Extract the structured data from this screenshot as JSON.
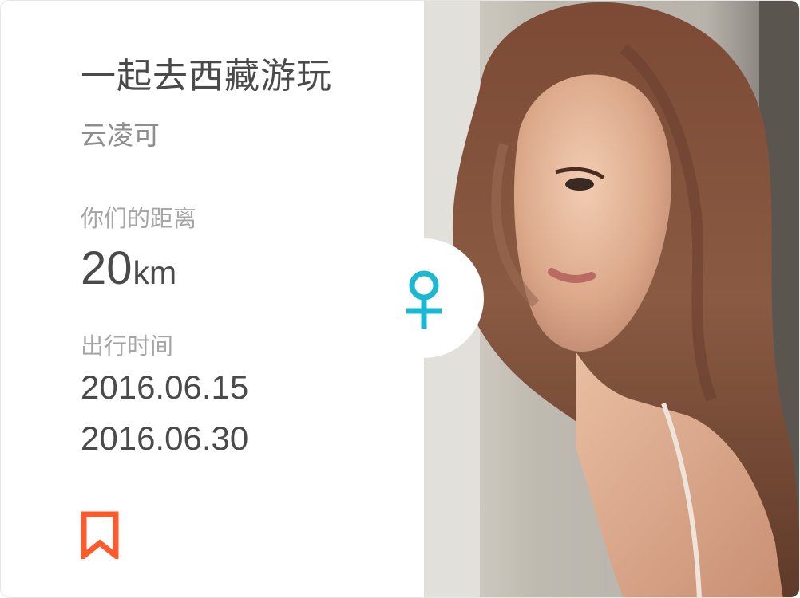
{
  "trip": {
    "title": "一起去西藏游玩",
    "author": "云凌可",
    "distance_label": "你们的距离",
    "distance_value": "20",
    "distance_unit": "km",
    "time_label": "出行时间",
    "start_date": "2016.06.15",
    "end_date": "2016.06.30"
  },
  "icons": {
    "bookmark": "bookmark-icon",
    "gender": "female-icon",
    "photo": "profile-photo"
  },
  "colors": {
    "accent_orange": "#ff5a2c",
    "gender_cyan": "#1cb8d1",
    "text_dark": "#4a4a4a",
    "text_muted": "#a6a6a6"
  }
}
